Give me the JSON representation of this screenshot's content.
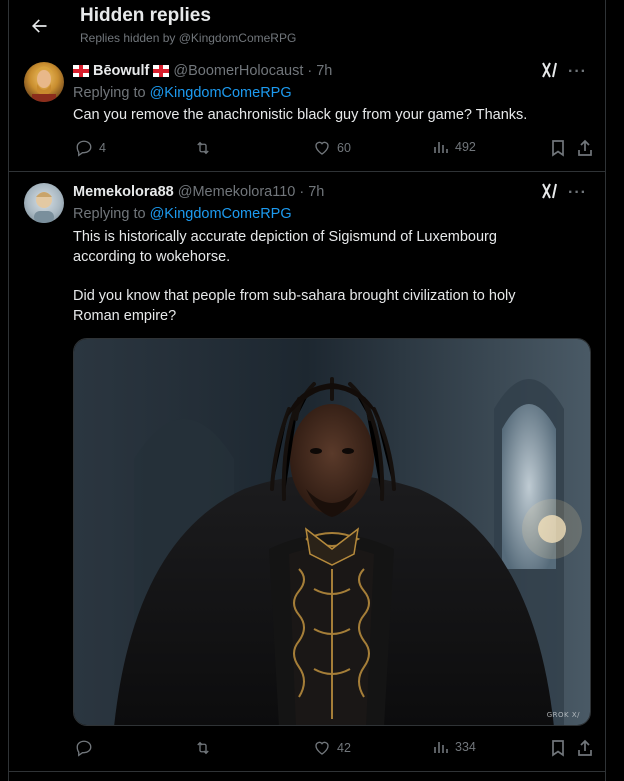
{
  "header": {
    "title": "Hidden replies",
    "subtitle": "Replies hidden by @KingdomComeRPG"
  },
  "tweets": [
    {
      "name": "Bēowulf",
      "handle": "@BoomerHolocaust",
      "time": "· 7h",
      "replying_label": "Replying to",
      "replying_to": "@KingdomComeRPG",
      "text": "Can you remove the anachronistic black guy from your game? Thanks.",
      "stats": {
        "replies": "4",
        "retweets": "",
        "likes": "60",
        "views": "492"
      }
    },
    {
      "name": "Memekolora88",
      "handle": "@Memekolora110",
      "time": "· 7h",
      "replying_label": "Replying to",
      "replying_to": "@KingdomComeRPG",
      "text_p1": "This is historically accurate depiction of Sigismund of Luxembourg according to wokehorse.",
      "text_p2": "Did you know that people from sub-sahara brought civilization to holy Roman empire?",
      "media_watermark": "GROK",
      "stats": {
        "replies": "",
        "retweets": "",
        "likes": "42",
        "views": "334"
      }
    }
  ],
  "icons": {
    "back": "arrow-left-icon",
    "grok": "grok-icon",
    "more": "more-icon",
    "reply": "reply-icon",
    "retweet": "retweet-icon",
    "like": "heart-icon",
    "views": "views-icon",
    "bookmark": "bookmark-icon",
    "share": "share-icon"
  },
  "colors": {
    "background": "#000000",
    "text": "#e7e9ea",
    "muted": "#71767b",
    "link": "#1d9bf0",
    "border": "#2f3336"
  }
}
